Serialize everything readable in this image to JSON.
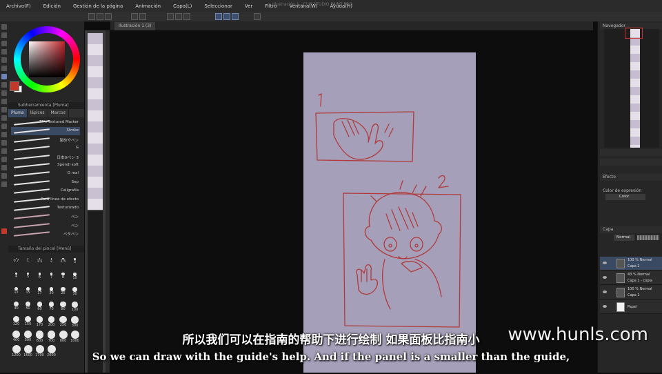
{
  "window": {
    "title": "Illustración 1 - CLIP STUDIO PAINT PRO"
  },
  "menu": [
    "Archivo(F)",
    "Edición",
    "Gestión de la página",
    "Animación",
    "Capa(L)",
    "Seleccionar",
    "Ver",
    "Filtro",
    "Ventana(W)",
    "Ayuda(H)"
  ],
  "canvas": {
    "tab_label": "Ilustración 1 (3)"
  },
  "brush_panel": {
    "header": "Subherramienta [Pluma]",
    "tabs": [
      "Pluma",
      "lápices",
      "Marcos"
    ],
    "brushes": [
      {
        "name": "TT's Textured Marker"
      },
      {
        "name": "Stroke"
      },
      {
        "name": "製めやペン"
      },
      {
        "name": "G"
      },
      {
        "name": "日本Gペン 3"
      },
      {
        "name": "Spendl soft"
      },
      {
        "name": "G real"
      },
      {
        "name": "Sep"
      },
      {
        "name": "Caligrafía"
      },
      {
        "name": "Para línea de efecto"
      },
      {
        "name": "Texturizado"
      },
      {
        "name": "ペン"
      },
      {
        "name": "ペン"
      },
      {
        "name": "ベタペン"
      }
    ]
  },
  "size_panel": {
    "header": "Tamaño del pincel [Menú]",
    "sizes": [
      "0.7",
      "1",
      "1.5",
      "2",
      "2.5",
      "3",
      "4",
      "5",
      "6",
      "7",
      "8",
      "10",
      "12",
      "15",
      "17",
      "20",
      "25",
      "30",
      "40",
      "50",
      "60",
      "70",
      "80",
      "100",
      "120",
      "150",
      "170",
      "200",
      "250",
      "300",
      "400",
      "500",
      "600",
      "700",
      "800",
      "1000",
      "1200",
      "1500",
      "1700",
      "2000"
    ]
  },
  "right_panel": {
    "navigator_label": "Navegador",
    "effect_label": "Efecto",
    "color_expr_label": "Color de expresión",
    "color_expr_value": "Color",
    "layer_label": "Capa",
    "blend_mode": "Normal",
    "layers": [
      {
        "opacity": "100 % Normal",
        "name": "Capa 2",
        "selected": true
      },
      {
        "opacity": "43 % Normal",
        "name": "Capa 1 - copia",
        "selected": false
      },
      {
        "opacity": "100 % Normal",
        "name": "Capa 1",
        "selected": false
      },
      {
        "opacity": "",
        "name": "Papel",
        "selected": false
      }
    ]
  },
  "subtitles": {
    "chinese": "所以我们可以在指南的帮助下进行绘制 如果面板比指南小",
    "english": "So we can draw with the guide's help. And if the panel is a smaller than the guide,"
  },
  "watermark": "www.hunls.com",
  "colors": {
    "accent": "#3b4a63",
    "sketch": "#b03a3a",
    "paper": "#a69fb9",
    "current_color": "#c0392b"
  }
}
